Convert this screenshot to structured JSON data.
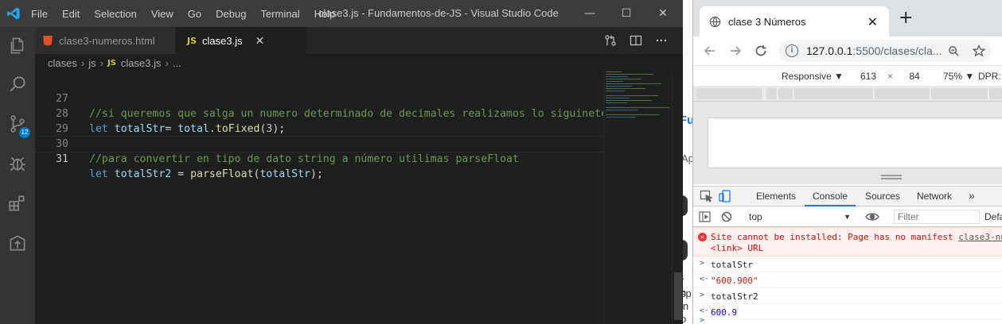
{
  "vscode": {
    "menu": [
      "File",
      "Edit",
      "Selection",
      "View",
      "Go",
      "Debug",
      "Terminal",
      "Help"
    ],
    "window_title": "clase3.js - Fundamentos-de-JS - Visual Studio Code",
    "controls": {
      "minimize": "—",
      "maximize": "☐",
      "close": "✕"
    },
    "activity_badge": "12",
    "tabs": [
      {
        "label": "clase3-numeros.html"
      },
      {
        "label": "clase3.js",
        "icon_text": "JS",
        "close": "✕"
      }
    ],
    "breadcrumb": {
      "folder1": "clases",
      "folder2": "js",
      "file": "clase3.js",
      "more": "..."
    },
    "lines": [
      {
        "num": "27",
        "comment": "//si queremos que salga un numero determinado de decimales realizamos lo siguinete"
      },
      {
        "num": "28",
        "kw": "let",
        "var": "totalStr",
        "eq": "=",
        "obj": "total",
        "dot": ".",
        "fn": "toFixed",
        "open": "(",
        "arg": "3",
        "close": ");"
      },
      {
        "num": "29"
      },
      {
        "num": "30",
        "comment": "//para convertir en tipo de dato string a número utilimas parseFloat"
      },
      {
        "num": "31",
        "kw": "let",
        "var": "totalStr2",
        "eq": "=",
        "fn": "parseFloat",
        "open": "(",
        "arg": "totalStr",
        "close": ");"
      }
    ]
  },
  "chrome": {
    "tab_title": "clase 3 Números",
    "tab_close": "✕",
    "new_tab": "+",
    "url_host": "127.0.0.1",
    "url_path": ":5500/clases/cla...",
    "device": {
      "mode": "Responsive ▼",
      "width": "613",
      "times": "×",
      "height": "84",
      "zoom": "75% ▼",
      "dpr": "DPR:"
    },
    "devtools_tabs": [
      "Elements",
      "Console",
      "Sources",
      "Network",
      "»"
    ],
    "context": "top",
    "filter_placeholder": "Filter",
    "levels": "Defa",
    "error_line1": "Site cannot be installed: Page has no manifest ",
    "error_link": "clase3-nu",
    "error_line2": "<link> URL",
    "entries": [
      {
        "prompt": ">",
        "text": "totalStr"
      },
      {
        "prompt": "<·",
        "text": "\"600.900\""
      },
      {
        "prompt": ">",
        "text": "totalStr2"
      },
      {
        "prompt": "<·",
        "text": "600.9"
      }
    ],
    "prompt": ">"
  },
  "behind_fragments": [
    "Fu",
    "Ap",
    "r n",
    "sp",
    "in",
    "o"
  ],
  "colors": {
    "vscode_bg": "#1e1e1e",
    "titlebar": "#3c3c3c",
    "activitybar": "#333333",
    "accent": "#007acc",
    "comment": "#6a9955",
    "keyword": "#569cd6"
  }
}
